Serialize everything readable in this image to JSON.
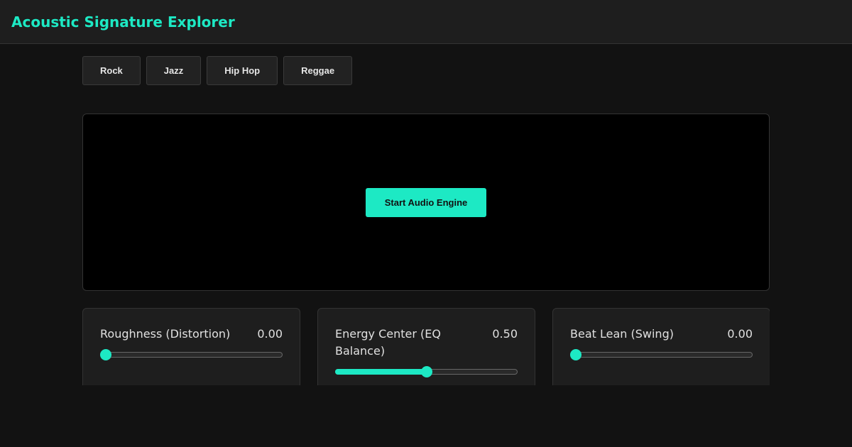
{
  "app": {
    "title": "Acoustic Signature Explorer"
  },
  "genres": [
    "Rock",
    "Jazz",
    "Hip Hop",
    "Reggae"
  ],
  "visualizer": {
    "start_label": "Start Audio Engine"
  },
  "controls": [
    {
      "label": "Roughness (Distortion)",
      "value_text": "0.00",
      "value": 0.0
    },
    {
      "label": "Energy Center (EQ Balance)",
      "value_text": "0.50",
      "value": 0.5
    },
    {
      "label": "Beat Lean (Swing)",
      "value_text": "0.00",
      "value": 0.0
    }
  ],
  "colors": {
    "accent": "#1de9c4",
    "background": "#121212",
    "panel": "#1e1e1e"
  }
}
